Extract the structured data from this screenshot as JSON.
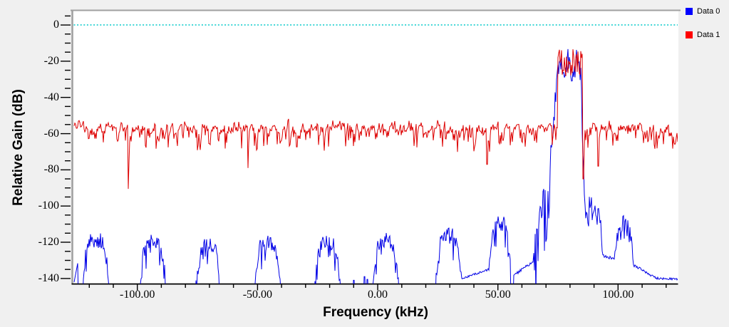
{
  "chart_data": {
    "type": "line",
    "title": "",
    "xlabel": "Frequency (kHz)",
    "ylabel": "Relative Gain (dB)",
    "xlim": [
      -126.3,
      124.8
    ],
    "ylim": [
      -143,
      7.5
    ],
    "grid": false,
    "x_axis": {
      "major_ticks": [
        -100,
        -50,
        0,
        50,
        100
      ],
      "major_labels": [
        "-100.00",
        "-50.00",
        "0.00",
        "50.00",
        "100.00"
      ],
      "minor_step": 10
    },
    "y_axis": {
      "major_ticks": [
        0,
        -20,
        -40,
        -60,
        -80,
        -100,
        -120,
        -140
      ],
      "major_labels": [
        "0",
        "-20",
        "-40",
        "-60",
        "-80",
        "-100",
        "-120",
        "-140"
      ],
      "minor_step": 5
    },
    "reference_line": {
      "y": 0,
      "color": "#00c8c8",
      "style": "dotted"
    },
    "legend_position": "top-right",
    "legend": {
      "entries": [
        {
          "label": "Data 0",
          "color": "#0000ff"
        },
        {
          "label": "Data 1",
          "color": "#ff0000"
        }
      ]
    },
    "series": [
      {
        "name": "Data 0",
        "color": "#0000e6",
        "description": "Near-floor comb of noisy spectral humps spaced ~25 kHz apart, strong signal block centered near 80 kHz reaching -13 dB",
        "floor_db": -152,
        "seed": 20240601,
        "left_edge": {
          "to": -124.8,
          "level": -131.5
        },
        "humps": [
          {
            "center": -117.3,
            "peak": -118.0,
            "half_width": 5.0
          },
          {
            "center": -93.6,
            "peak": -119.5,
            "half_width": 5.0
          },
          {
            "center": -70.5,
            "peak": -121.0,
            "half_width": 4.8
          },
          {
            "center": -45.8,
            "peak": -119.5,
            "half_width": 5.0
          },
          {
            "center": -20.8,
            "peak": -120.0,
            "half_width": 4.8
          },
          {
            "center": 3.3,
            "peak": -118.5,
            "half_width": 5.0
          },
          {
            "center": 29.5,
            "peak": -115.5,
            "half_width": 4.8
          },
          {
            "center": 50.8,
            "peak": -108.5,
            "half_width": 4.0
          },
          {
            "center": 102.4,
            "peak": -109.0,
            "half_width": 3.8
          }
        ],
        "blips": [
          {
            "x": -9.9,
            "level": -141.0
          },
          {
            "x": -5.6,
            "level": -139.0
          },
          {
            "x": -4.3,
            "level": -140.5
          }
        ],
        "ramps": [
          {
            "from": 34.2,
            "to": 49.4,
            "start": -140.5,
            "end": -133.5,
            "noise": 1.2
          },
          {
            "from": 56.4,
            "to": 64.8,
            "start": -138.5,
            "end": -130.5,
            "noise": 1.6
          },
          {
            "from": 93.4,
            "to": 98.9,
            "start": -127.5,
            "end": -129.2,
            "noise": 1.6
          },
          {
            "from": 106.2,
            "to": 116.0,
            "start": -132.5,
            "end": -139.8,
            "noise": 1.5
          },
          {
            "from": 116.0,
            "to": 124.8,
            "start": -139.8,
            "end": -140.6,
            "noise": 1.4
          }
        ],
        "main_peak": {
          "skirt": {
            "from": 64.8,
            "to": 71.8,
            "top_start": -112,
            "top_end": -76,
            "depth": 38
          },
          "rise": {
            "from": 71.8,
            "to": 74.9,
            "end_level": -23
          },
          "top": {
            "from": 74.9,
            "to": 84.3,
            "mean": -23,
            "spread": 13,
            "max": -13
          },
          "fall": {
            "from": 84.3,
            "to": 86.0,
            "end_level": -92
          },
          "shoulder": {
            "from": 86.0,
            "to": 92.6,
            "mean": -104,
            "spread": 11
          },
          "drop": {
            "from": 92.6,
            "to": 93.4,
            "end_level": -126
          }
        }
      },
      {
        "name": "Data 1",
        "color": "#dd0000",
        "description": "Broadband noise floor around -57 dB across the full span with downward fades, sharing the -13 dB signal block near 80 kHz",
        "seed": 987654,
        "baseline": {
          "mean": -57.5,
          "upper_band": [
            -50,
            -54.5
          ],
          "mid_band": [
            -54.5,
            -61
          ],
          "dip_band": [
            -62,
            -69
          ],
          "deep_band": [
            -69,
            -77
          ]
        },
        "deep_fades": [
          {
            "x": -103.8,
            "level": -90.5
          },
          {
            "x": -54.0,
            "level": -79.0
          },
          {
            "x": 45.5,
            "level": -77.0
          },
          {
            "x": 85.6,
            "level": -85.0
          },
          {
            "x": 91.8,
            "level": -78.0
          }
        ],
        "top": {
          "from": 74.7,
          "to": 85.2,
          "mean": -20.5,
          "spread": 13,
          "max": -12.3
        }
      }
    ]
  }
}
